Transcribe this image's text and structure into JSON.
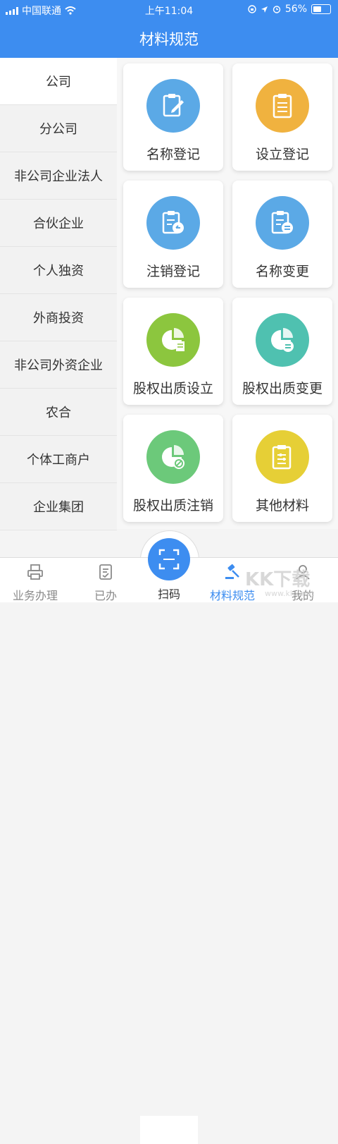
{
  "status_bar": {
    "carrier": "中国联通",
    "time": "上午11:04",
    "battery": "56%",
    "battery_level": 0.56
  },
  "header": {
    "title": "材料规范"
  },
  "sidebar": {
    "items": [
      {
        "label": "公司"
      },
      {
        "label": "分公司"
      },
      {
        "label": "非公司企业法人"
      },
      {
        "label": "合伙企业"
      },
      {
        "label": "个人独资"
      },
      {
        "label": "外商投资"
      },
      {
        "label": "非公司外资企业"
      },
      {
        "label": "农合"
      },
      {
        "label": "个体工商户"
      },
      {
        "label": "企业集团"
      }
    ]
  },
  "cards": [
    {
      "label": "名称登记",
      "icon": "clipboard-edit-icon",
      "color": "#5ba9e6"
    },
    {
      "label": "设立登记",
      "icon": "clipboard-list-icon",
      "color": "#f0b23f"
    },
    {
      "label": "注销登记",
      "icon": "clipboard-cancel-icon",
      "color": "#5ba9e6"
    },
    {
      "label": "名称变更",
      "icon": "clipboard-swap-icon",
      "color": "#5ba9e6"
    },
    {
      "label": "股权出质设立",
      "icon": "pie-chart-document-icon",
      "color": "#8cc63e"
    },
    {
      "label": "股权出质变更",
      "icon": "pie-chart-swap-icon",
      "color": "#4fc1b0"
    },
    {
      "label": "股权出质注销",
      "icon": "pie-chart-cancel-icon",
      "color": "#6cc97a"
    },
    {
      "label": "其他材料",
      "icon": "clipboard-sliders-icon",
      "color": "#e6cf36"
    }
  ],
  "tabbar": {
    "tabs": [
      {
        "label": "业务办理",
        "icon": "printer-icon"
      },
      {
        "label": "已办",
        "icon": "checklist-icon"
      },
      {
        "label": "扫码",
        "icon": "scan-icon"
      },
      {
        "label": "材料规范",
        "icon": "gavel-icon"
      },
      {
        "label": "我的",
        "icon": "user-icon"
      }
    ]
  },
  "watermark": {
    "text": "KK下载",
    "sub": "www.kkx.net"
  },
  "colors": {
    "primary": "#3d8df0"
  }
}
